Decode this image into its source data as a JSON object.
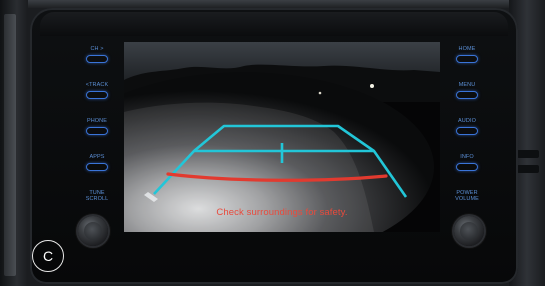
{
  "screen": {
    "warning": "Check surroundings for safety."
  },
  "buttons_left": [
    {
      "label": "CH >"
    },
    {
      "label": "<TRACK"
    },
    {
      "label": "PHONE"
    },
    {
      "label": "APPS"
    },
    {
      "label": "TUNE SCROLL"
    }
  ],
  "buttons_right": [
    {
      "label": "HOME"
    },
    {
      "label": "MENU"
    },
    {
      "label": "AUDIO"
    },
    {
      "label": "INFO"
    },
    {
      "label": "POWER VOLUME"
    }
  ],
  "figure_badge": "C",
  "colors": {
    "guide_cyan": "#22c6d8",
    "guide_red": "#e23a2f",
    "button_blue": "#3a74d8",
    "warning_red": "#e94a3c"
  }
}
